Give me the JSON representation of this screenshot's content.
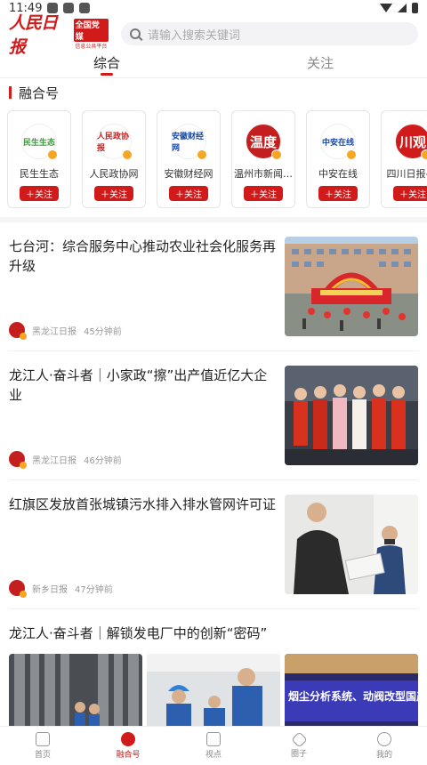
{
  "status": {
    "time": "11:49"
  },
  "header": {
    "logo_text": "人民日报",
    "logo_badge": "全国党媒",
    "logo_badge_sub": "信息公共平台",
    "search_placeholder": "请输入搜索关键词"
  },
  "tabs": [
    {
      "label": "综合",
      "active": true
    },
    {
      "label": "关注",
      "active": false
    }
  ],
  "section": {
    "title": "融合号"
  },
  "accounts": [
    {
      "name": "民生生态",
      "logo_text": "民生生态",
      "color": "#3a9d3a",
      "follow": "＋关注"
    },
    {
      "name": "人民政协网",
      "logo_text": "人民政协报",
      "color": "#d11a1a",
      "follow": "＋关注"
    },
    {
      "name": "安徽财经网",
      "logo_text": "安徽财经网",
      "color": "#1a4aa8",
      "follow": "＋关注"
    },
    {
      "name": "温州市新闻…",
      "logo_text": "温度",
      "color": "#c41e1e",
      "follow": "＋关注"
    },
    {
      "name": "中安在线",
      "logo_text": "中安在线",
      "color": "#1a4aa8",
      "follow": "＋关注"
    },
    {
      "name": "四川日报-…",
      "logo_text": "川观",
      "color": "#d11a1a",
      "follow": "＋关注"
    }
  ],
  "articles": [
    {
      "title": "七台河：综合服务中心推动农业社会化服务再升级",
      "source": "黑龙江日报",
      "time": "45分钟前"
    },
    {
      "title": "龙江人·奋斗者｜小家政“擦”出产值近亿大企业",
      "source": "黑龙江日报",
      "time": "46分钟前"
    },
    {
      "title": "红旗区发放首张城镇污水排入排水管网许可证",
      "source": "新乡日报",
      "time": "47分钟前"
    }
  ],
  "article_last": {
    "title": "龙江人·奋斗者｜解锁发电厂中的创新“密码”",
    "thumb3_text": "烟尘分析系统、动阀改型国产化"
  },
  "bottom_nav": [
    {
      "label": "首页",
      "active": false
    },
    {
      "label": "融合号",
      "active": true
    },
    {
      "label": "视点",
      "active": false
    },
    {
      "label": "圈子",
      "active": false
    },
    {
      "label": "我的",
      "active": false
    }
  ]
}
